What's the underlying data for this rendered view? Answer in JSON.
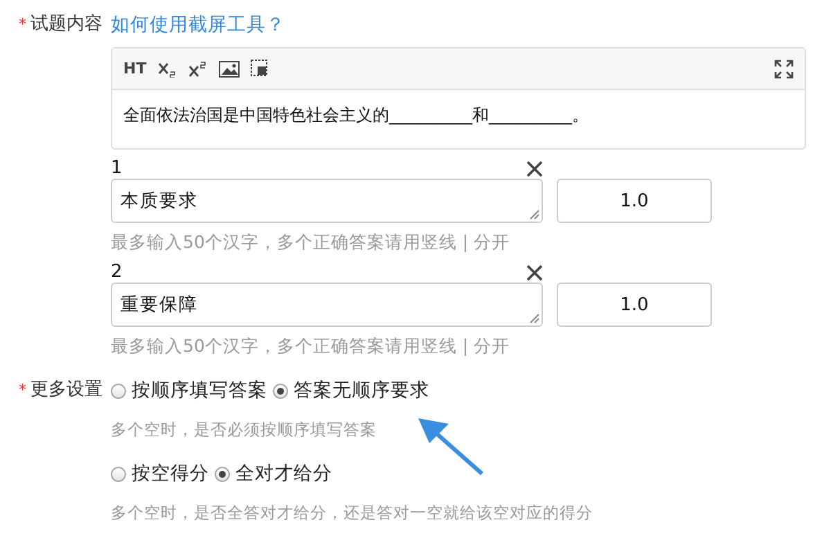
{
  "content_field": {
    "label": "试题内容",
    "required": "*",
    "help_link": "如何使用截屏工具？",
    "toolbar": {
      "html_button": "HT"
    },
    "text": "全面依法治国是中国特色社会主义的__________和__________。"
  },
  "answers": [
    {
      "number": "1",
      "value": "本质要求",
      "score": "1.0",
      "hint": "最多输入50个汉字，多个正确答案请用竖线 | 分开"
    },
    {
      "number": "2",
      "value": "重要保障",
      "score": "1.0",
      "hint": "最多输入50个汉字，多个正确答案请用竖线 | 分开"
    }
  ],
  "more_settings": {
    "label": "更多设置",
    "required": "*",
    "groups": [
      {
        "options": [
          {
            "label": "按顺序填写答案",
            "selected": false
          },
          {
            "label": "答案无顺序要求",
            "selected": true
          }
        ],
        "hint": "多个空时，是否必须按顺序填写答案"
      },
      {
        "options": [
          {
            "label": "按空得分",
            "selected": false
          },
          {
            "label": "全对才给分",
            "selected": true
          }
        ],
        "hint": "多个空时，是否全答对才给分，还是答对一空就给该空对应的得分"
      }
    ]
  }
}
